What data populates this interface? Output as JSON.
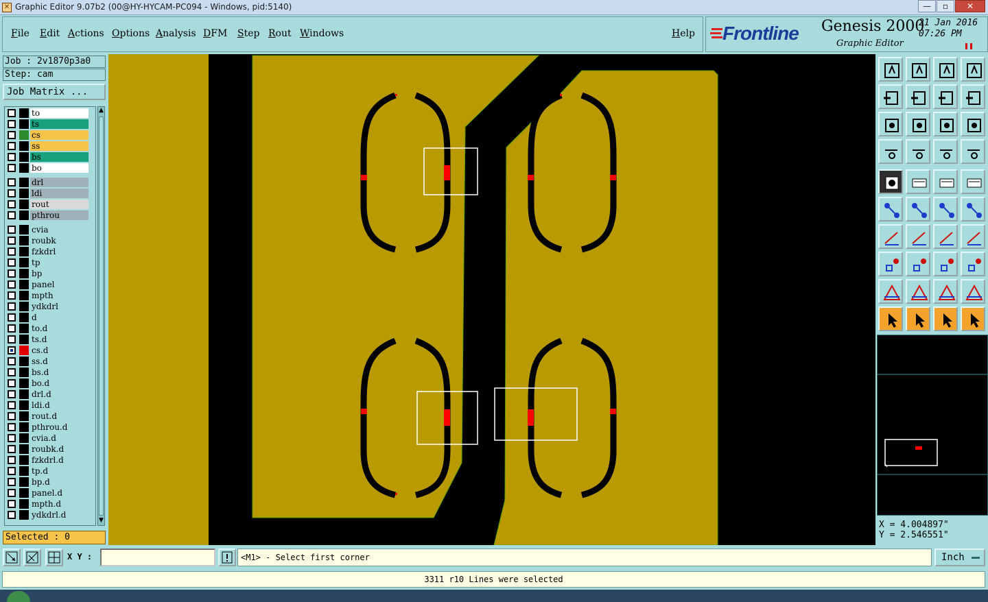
{
  "window": {
    "title": "Graphic Editor 9.07b2 (00@HY-HYCAM-PC094 - Windows, pid:5140)",
    "controls": [
      "—",
      "▫",
      "✕"
    ]
  },
  "menu": {
    "items": [
      "File",
      "Edit",
      "Actions",
      "Options",
      "Analysis",
      "DFM",
      "Step",
      "Rout",
      "Windows"
    ],
    "help": "Help"
  },
  "brand": {
    "logo": "Frontline",
    "product": "Genesis 2000",
    "subtitle": "Graphic Editor",
    "date": "21 Jan 2016",
    "time": "07:26 PM"
  },
  "job": {
    "job_line": "Job : 2v1870p3a0",
    "step_line": "Step: cam",
    "matrix_button": "Job Matrix ..."
  },
  "layers": [
    {
      "name": "to",
      "color": "#ffffff",
      "swatch": "#000000"
    },
    {
      "name": "ts",
      "color": "#17a07b",
      "swatch": "#000000"
    },
    {
      "name": "cs",
      "color": "#f7c44a",
      "swatch": "#2d8a2d"
    },
    {
      "name": "ss",
      "color": "#f7c44a",
      "swatch": "#000000"
    },
    {
      "name": "bs",
      "color": "#17a07b",
      "swatch": "#000000"
    },
    {
      "name": "bo",
      "color": "#ffffff",
      "swatch": "#000000"
    },
    {
      "name": "drl",
      "color": "#9fb0b8",
      "swatch": "#000000"
    },
    {
      "name": "ldi",
      "color": "#9fb0b8",
      "swatch": "#000000"
    },
    {
      "name": "rout",
      "color": "#dadada",
      "swatch": "#000000"
    },
    {
      "name": "pthrou",
      "color": "#9fb0b8",
      "swatch": "#000000"
    },
    {
      "name": "cvia",
      "color": "#a8dcdc",
      "swatch": "#000000"
    },
    {
      "name": "roubk",
      "color": "#a8dcdc",
      "swatch": "#000000"
    },
    {
      "name": "fzkdrl",
      "color": "#a8dcdc",
      "swatch": "#000000"
    },
    {
      "name": "tp",
      "color": "#a8dcdc",
      "swatch": "#000000"
    },
    {
      "name": "bp",
      "color": "#a8dcdc",
      "swatch": "#000000"
    },
    {
      "name": "panel",
      "color": "#a8dcdc",
      "swatch": "#000000"
    },
    {
      "name": "mpth",
      "color": "#a8dcdc",
      "swatch": "#000000"
    },
    {
      "name": "ydkdrl",
      "color": "#a8dcdc",
      "swatch": "#000000"
    },
    {
      "name": "d",
      "color": "#a8dcdc",
      "swatch": "#000000"
    },
    {
      "name": "to.d",
      "color": "#a8dcdc",
      "swatch": "#000000"
    },
    {
      "name": "ts.d",
      "color": "#a8dcdc",
      "swatch": "#000000"
    },
    {
      "name": "cs.d",
      "color": "#a8dcdc",
      "swatch": "#e00000",
      "active": true
    },
    {
      "name": "ss.d",
      "color": "#a8dcdc",
      "swatch": "#000000"
    },
    {
      "name": "bs.d",
      "color": "#a8dcdc",
      "swatch": "#000000"
    },
    {
      "name": "bo.d",
      "color": "#a8dcdc",
      "swatch": "#000000"
    },
    {
      "name": "drl.d",
      "color": "#a8dcdc",
      "swatch": "#000000"
    },
    {
      "name": "ldi.d",
      "color": "#a8dcdc",
      "swatch": "#000000"
    },
    {
      "name": "rout.d",
      "color": "#a8dcdc",
      "swatch": "#000000"
    },
    {
      "name": "pthrou.d",
      "color": "#a8dcdc",
      "swatch": "#000000"
    },
    {
      "name": "cvia.d",
      "color": "#a8dcdc",
      "swatch": "#000000"
    },
    {
      "name": "roubk.d",
      "color": "#a8dcdc",
      "swatch": "#000000"
    },
    {
      "name": "fzkdrl.d",
      "color": "#a8dcdc",
      "swatch": "#000000"
    },
    {
      "name": "tp.d",
      "color": "#a8dcdc",
      "swatch": "#000000"
    },
    {
      "name": "bp.d",
      "color": "#a8dcdc",
      "swatch": "#000000"
    },
    {
      "name": "panel.d",
      "color": "#a8dcdc",
      "swatch": "#000000"
    },
    {
      "name": "mpth.d",
      "color": "#a8dcdc",
      "swatch": "#000000"
    },
    {
      "name": "ydkdrl.d",
      "color": "#a8dcdc",
      "swatch": "#000000"
    }
  ],
  "selected": "Selected : 0",
  "coords": {
    "x": "X = 4.004897\"",
    "y": "Y = 2.546551\""
  },
  "command": {
    "xy_label": "X Y :",
    "xy_value": "",
    "prompt": "<M1> - Select first corner",
    "units": "Inch"
  },
  "status": "3311 r10 Lines were selected",
  "colors": {
    "copper": "#b99a00",
    "background": "#000000",
    "highlight": "#ff0000",
    "panel": "#a8dcdc"
  }
}
